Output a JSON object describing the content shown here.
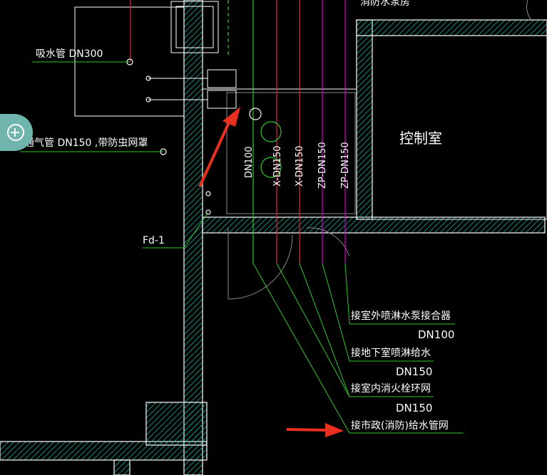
{
  "labels": {
    "top_room": "消防水泵房",
    "suction_pipe": "吸水管 DN300",
    "vent_pipe": "通气管 DN150 ,带防虫网罩",
    "control_room": "控制室",
    "pipe_dn100": "DN100",
    "pipe_x_dn150": "X-DN150",
    "pipe_x_dn150_b": "X-DN150",
    "pipe_zp_dn150": "ZP-DN150",
    "pipe_zp_dn150_b": "ZP-DN150",
    "fd": "Fd-1",
    "note1": "接室外喷淋水泵接合器",
    "note1_size": "DN100",
    "note2": "接地下室喷淋给水",
    "note2_size": "DN150",
    "note3": "接室内消火栓环网",
    "note3_size": "DN150",
    "note4": "接市政(消防)给水管网"
  },
  "icons": {
    "zoom": "zoom-in-icon",
    "arrow_upper": "red-arrow-icon",
    "arrow_lower": "red-arrow-icon"
  },
  "colors": {
    "background": "#000000",
    "wall": "#ffffff",
    "green": "#2ec82e",
    "red": "#e02040",
    "magenta": "#d000d0",
    "cyan_hatch": "#00b0a0",
    "arrow": "#e83020",
    "zoom_button": "#6fb5ad"
  }
}
